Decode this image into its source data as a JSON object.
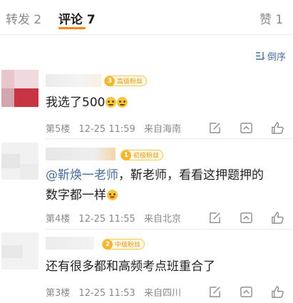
{
  "tabs": [
    {
      "label": "转发 2"
    },
    {
      "label": "评论 7"
    },
    {
      "label": "赞 1"
    }
  ],
  "sort": {
    "label": "倒序",
    "icon": "sort-icon"
  },
  "colors": {
    "accent": "#ff8200",
    "link": "#4a6f9c",
    "meta": "#8a8a8a",
    "badge": "#f5b52c"
  },
  "comments": [
    {
      "badge": "高级粉丝",
      "badge_level": "3",
      "text": "我选了500",
      "mention": "",
      "emoji": [
        "tear-face-emoji",
        "tear-face-emoji"
      ],
      "floor": "第5楼",
      "time": "12-25 11:59",
      "location": "来自海南"
    },
    {
      "badge": "初级粉丝",
      "badge_level": "1",
      "mention": "@靳焕一老师",
      "text": "，靳老师，看看这押题押的",
      "text2": "数字都一样",
      "emoji": [
        "smile-emoji"
      ],
      "floor": "第4楼",
      "time": "12-25 11:55",
      "location": "来自北京"
    },
    {
      "badge": "中级粉丝",
      "badge_level": "2",
      "text": "还有很多都和高频考点班重合了",
      "floor": "第3楼",
      "time": "12-25 11:53",
      "location": "来自四川"
    }
  ]
}
